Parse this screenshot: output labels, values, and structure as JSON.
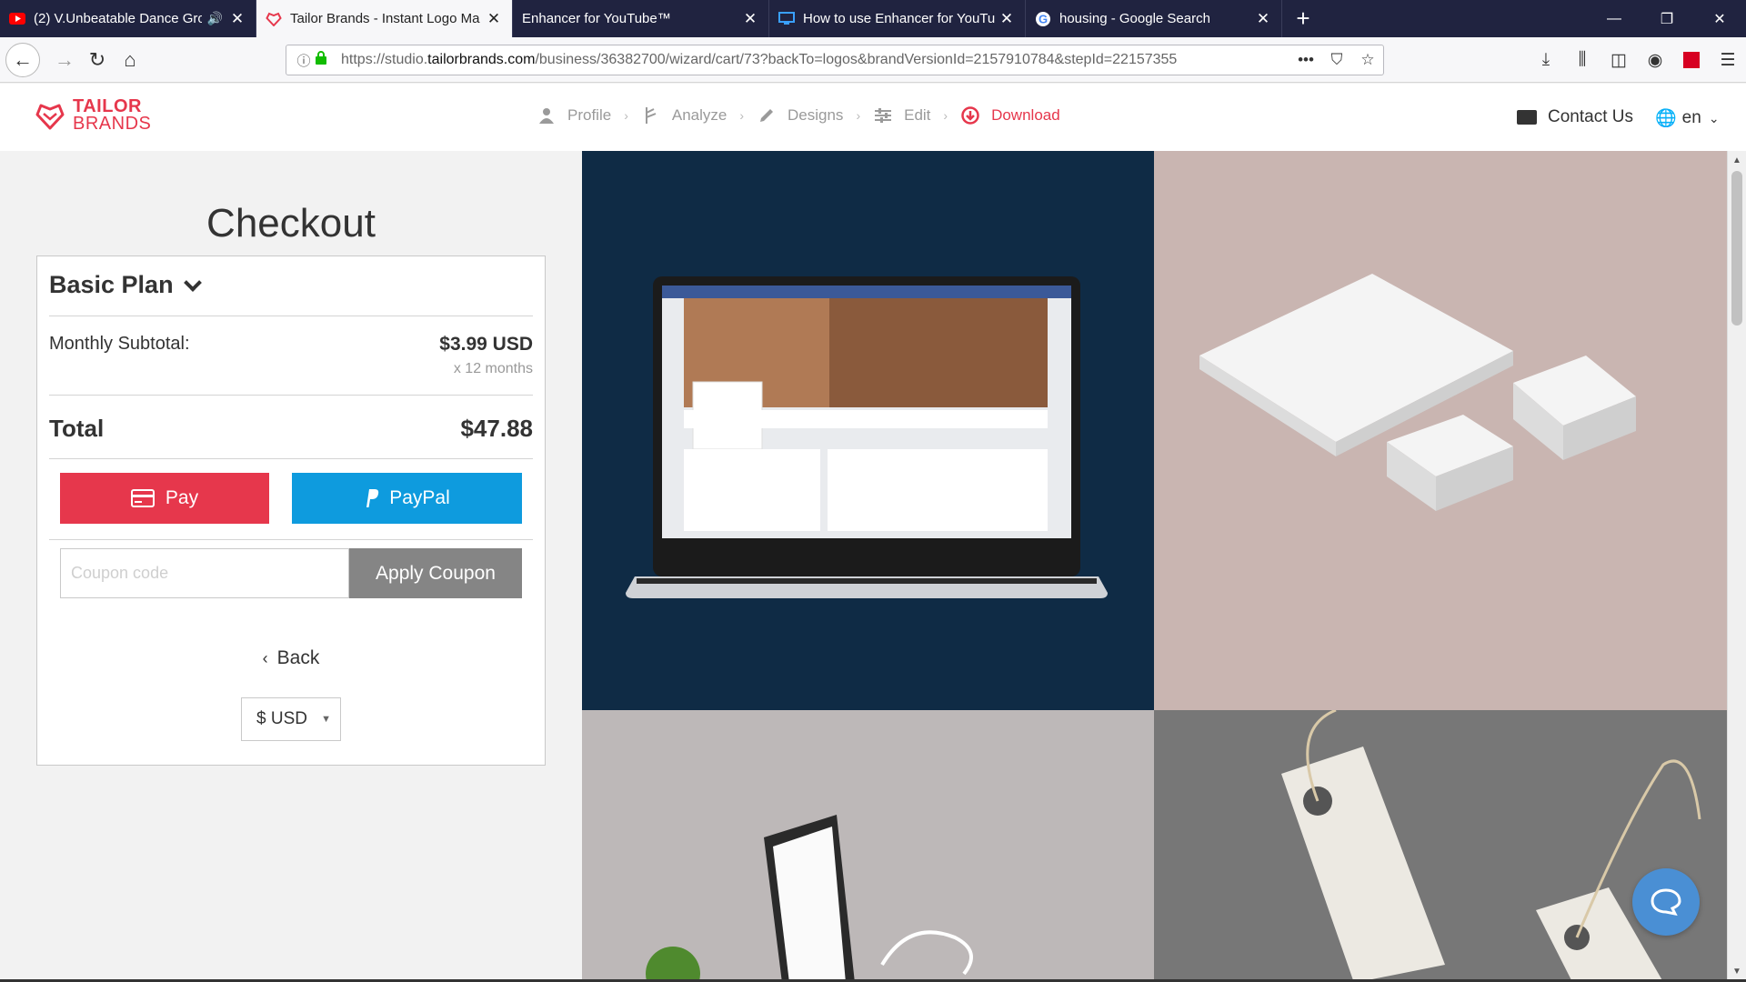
{
  "browser": {
    "tabs": [
      {
        "title": "(2) V.Unbeatable Dance Gro",
        "icon": "youtube-icon",
        "audio": true,
        "active": false
      },
      {
        "title": "Tailor Brands - Instant Logo Ma",
        "icon": "tailor-brands-icon",
        "audio": false,
        "active": true
      },
      {
        "title": "Enhancer for YouTube™",
        "icon": "",
        "audio": false,
        "active": false
      },
      {
        "title": "How to use Enhancer for YouTu",
        "icon": "monitor-icon",
        "audio": false,
        "active": false
      },
      {
        "title": "housing - Google Search",
        "icon": "google-icon",
        "audio": false,
        "active": false
      }
    ],
    "url_prefix": "https://studio.",
    "url_domain": "tailorbrands.com",
    "url_path": "/business/36382700/wizard/cart/73?backTo=logos&brandVersionId=2157910784&stepId=22157355"
  },
  "header": {
    "logo_line1": "TAILOR",
    "logo_line2": "BRANDS",
    "steps": [
      {
        "label": "Profile",
        "icon": "user-icon"
      },
      {
        "label": "Analyze",
        "icon": "analyze-icon"
      },
      {
        "label": "Designs",
        "icon": "pencil-icon"
      },
      {
        "label": "Edit",
        "icon": "sliders-icon"
      },
      {
        "label": "Download",
        "icon": "download-icon",
        "current": true
      }
    ],
    "contact_label": "Contact Us",
    "language": "en"
  },
  "checkout": {
    "title": "Checkout",
    "plan": "Basic Plan",
    "subtotal_label": "Monthly Subtotal:",
    "subtotal_value": "$3.99 USD",
    "months": "x 12 months",
    "total_label": "Total",
    "total_value": "$47.88",
    "pay_label": "Pay",
    "paypal_label": "PayPal",
    "coupon_placeholder": "Coupon code",
    "apply_label": "Apply Coupon",
    "back_label": "Back",
    "currency": "$ USD"
  },
  "colors": {
    "brand": "#e6374c",
    "paypal": "#0e9bde",
    "tabbar": "#202340"
  }
}
